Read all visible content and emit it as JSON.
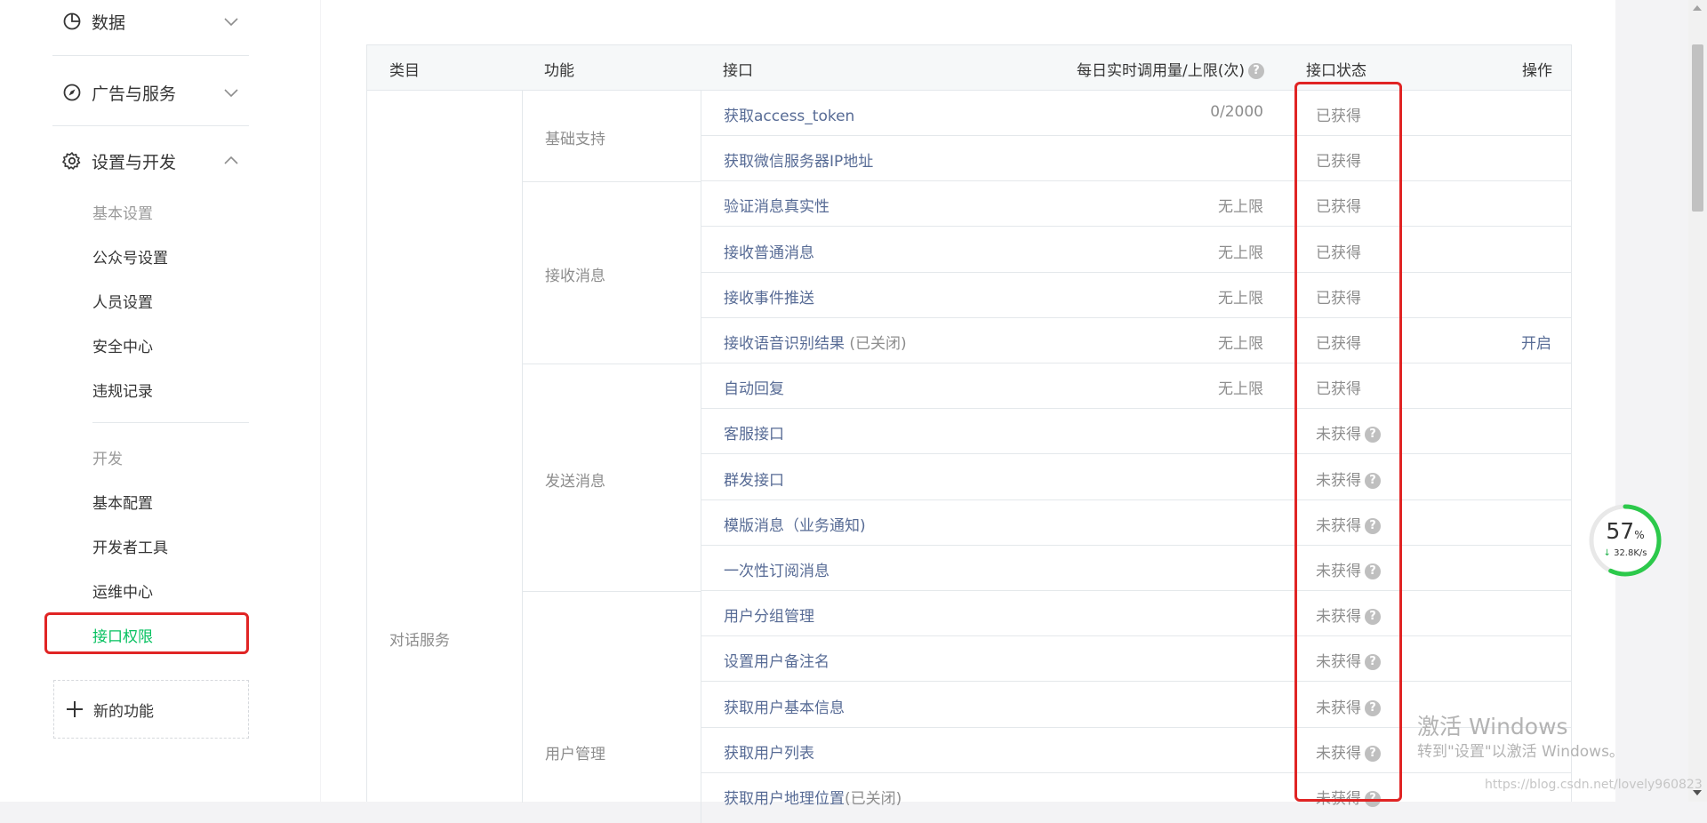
{
  "sidebar": {
    "sections": [
      {
        "label": "数据",
        "icon": "pie-chart-icon",
        "expanded": false
      },
      {
        "label": "广告与服务",
        "icon": "compass-icon",
        "expanded": false
      },
      {
        "label": "设置与开发",
        "icon": "gear-icon",
        "expanded": true
      }
    ],
    "settings_items": [
      "基本设置",
      "公众号设置",
      "人员设置",
      "安全中心",
      "违规记录"
    ],
    "dev_items": [
      "开发",
      "基本配置",
      "开发者工具",
      "运维中心",
      "接口权限"
    ],
    "new_feature_label": "新的功能"
  },
  "table": {
    "headers": {
      "category": "类目",
      "function": "功能",
      "api": "接口",
      "quota": "每日实时调用量/上限(次)",
      "status": "接口状态",
      "action": "操作"
    },
    "category": "对话服务",
    "groups": [
      "基础支持",
      "接收消息",
      "发送消息",
      "用户管理"
    ],
    "rows": [
      {
        "api": "获取access_token",
        "note": "",
        "quota": "0/2000",
        "status": "已获得",
        "help": false,
        "action": ""
      },
      {
        "api": "获取微信服务器IP地址",
        "note": "",
        "quota": "",
        "status": "已获得",
        "help": false,
        "action": ""
      },
      {
        "api": "验证消息真实性",
        "note": "",
        "quota": "无上限",
        "status": "已获得",
        "help": false,
        "action": ""
      },
      {
        "api": "接收普通消息",
        "note": "",
        "quota": "无上限",
        "status": "已获得",
        "help": false,
        "action": ""
      },
      {
        "api": "接收事件推送",
        "note": "",
        "quota": "无上限",
        "status": "已获得",
        "help": false,
        "action": ""
      },
      {
        "api": "接收语音识别结果",
        "note": " (已关闭)",
        "quota": "无上限",
        "status": "已获得",
        "help": false,
        "action": "开启"
      },
      {
        "api": "自动回复",
        "note": "",
        "quota": "无上限",
        "status": "已获得",
        "help": false,
        "action": ""
      },
      {
        "api": "客服接口",
        "note": "",
        "quota": "",
        "status": "未获得",
        "help": true,
        "action": ""
      },
      {
        "api": "群发接口",
        "note": "",
        "quota": "",
        "status": "未获得",
        "help": true,
        "action": ""
      },
      {
        "api": "模版消息（业务通知)",
        "note": "",
        "quota": "",
        "status": "未获得",
        "help": true,
        "action": ""
      },
      {
        "api": "一次性订阅消息",
        "note": "",
        "quota": "",
        "status": "未获得",
        "help": true,
        "action": ""
      },
      {
        "api": "用户分组管理",
        "note": "",
        "quota": "",
        "status": "未获得",
        "help": true,
        "action": ""
      },
      {
        "api": "设置用户备注名",
        "note": "",
        "quota": "",
        "status": "未获得",
        "help": true,
        "action": ""
      },
      {
        "api": "获取用户基本信息",
        "note": "",
        "quota": "",
        "status": "未获得",
        "help": true,
        "action": ""
      },
      {
        "api": "获取用户列表",
        "note": "",
        "quota": "",
        "status": "未获得",
        "help": true,
        "action": ""
      },
      {
        "api": "获取用户地理位置",
        "note": "(已关闭)",
        "quota": "",
        "status": "未获得",
        "help": true,
        "action": ""
      }
    ]
  },
  "gauge": {
    "percent": "57",
    "unit": "%",
    "speed": "32.8K/s",
    "level": 0.57
  },
  "watermark": {
    "title": "激活 Windows",
    "subtitle": "转到\"设置\"以激活 Windows。",
    "url": "https://blog.csdn.net/lovely960823"
  },
  "colors": {
    "accent_green": "#07c160",
    "link_blue": "#576b95",
    "highlight_red": "#e02424"
  }
}
